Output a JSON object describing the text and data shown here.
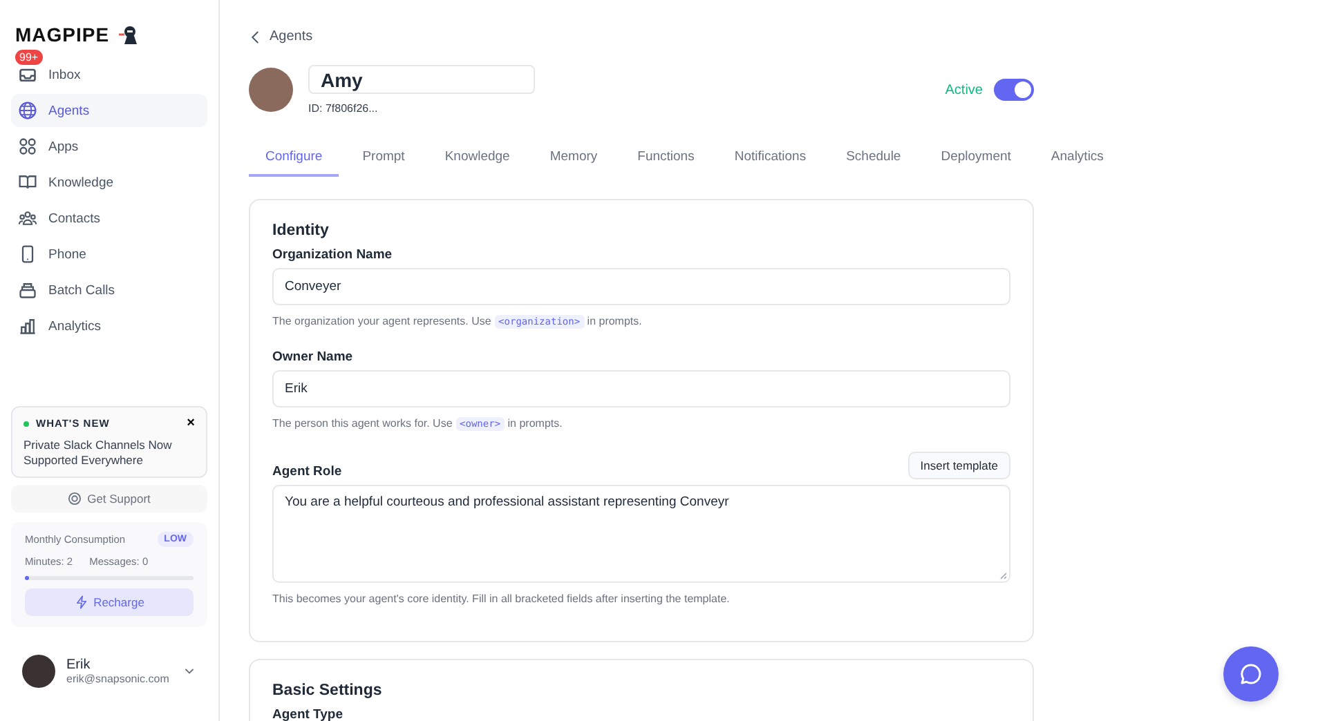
{
  "sidebar": {
    "logo": "MAGPIPE",
    "items": [
      {
        "label": "Inbox",
        "selected": false,
        "badge": "99+"
      },
      {
        "label": "Agents",
        "selected": true
      },
      {
        "label": "Apps",
        "selected": false
      },
      {
        "label": "Knowledge",
        "selected": false
      },
      {
        "label": "Contacts",
        "selected": false
      },
      {
        "label": "Phone",
        "selected": false
      },
      {
        "label": "Batch Calls",
        "selected": false
      },
      {
        "label": "Analytics",
        "selected": false
      }
    ],
    "whats_new": {
      "title": "WHAT'S NEW",
      "close": "×",
      "text": "Private Slack Channels Now Supported Everywhere"
    },
    "support": "Get Support",
    "consumption": {
      "title": "Monthly Consumption",
      "badge": "LOW",
      "minutes": "Minutes: 2",
      "messages": "Messages: 0",
      "level": 0.02,
      "button": "Recharge"
    },
    "user": {
      "name": "Erik",
      "email": "erik@snapsonic.com"
    }
  },
  "breadcrumb": "Agents",
  "agent": {
    "name": "Amy",
    "id": "ID: 7f806f26...",
    "status": "Active",
    "on": true
  },
  "tabs": [
    {
      "label": "Configure",
      "selected": true
    },
    {
      "label": "Prompt",
      "selected": false
    },
    {
      "label": "Knowledge",
      "selected": false
    },
    {
      "label": "Memory",
      "selected": false
    },
    {
      "label": "Functions",
      "selected": false
    },
    {
      "label": "Notifications",
      "selected": false
    },
    {
      "label": "Schedule",
      "selected": false
    },
    {
      "label": "Deployment",
      "selected": false
    },
    {
      "label": "Analytics",
      "selected": false
    }
  ],
  "identity": {
    "title": "Identity",
    "fields": [
      {
        "kind": "input",
        "label": "Organization Name",
        "value": "Conveyer",
        "hint": [
          {
            "kind": "text",
            "text": "The organization your agent represents. Use"
          },
          {
            "kind": "code",
            "text": "<organization>"
          },
          {
            "kind": "text",
            "text": "in prompts."
          }
        ]
      },
      {
        "kind": "input",
        "label": "Owner Name",
        "value": "Erik",
        "hint": [
          {
            "kind": "text",
            "text": "The person this agent works for. Use"
          },
          {
            "kind": "code",
            "text": "<owner>"
          },
          {
            "kind": "text",
            "text": "in prompts."
          }
        ]
      },
      {
        "kind": "textarea",
        "label": "Agent Role",
        "action": "Insert template",
        "value": "You are a helpful courteous and professional assistant representing Conveyr",
        "hint": [
          {
            "kind": "text",
            "text": "This becomes your agent's core identity. Fill in all bracketed fields after inserting the template."
          }
        ]
      }
    ]
  },
  "basic_settings": {
    "title": "Basic Settings",
    "field_label": "Agent Type"
  }
}
